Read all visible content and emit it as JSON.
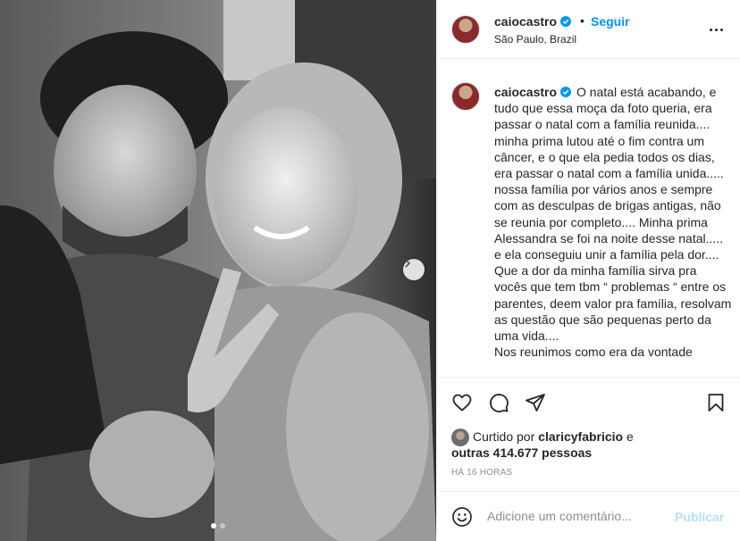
{
  "post": {
    "author": {
      "username": "caiocastro",
      "verified": true,
      "location": "São Paulo, Brazil"
    },
    "follow_label": "Seguir",
    "bullet": "•",
    "caption_text": "O natal está acabando, e tudo que essa moça da foto queria, era passar o natal com a família reunida.... minha prima lutou até o fim contra um câncer, e o que ela pedia todos os dias, era passar o natal com a família unida..... nossa família por vários anos e sempre com as desculpas de brigas antigas, não se reunia por completo.... Minha prima Alessandra se foi na noite desse natal..... e ela conseguiu unir a família pela dor....\nQue a dor da minha família sirva pra vocês que tem tbm “ problemas “ entre os parentes, deem valor pra família, resolvam as questão que são pequenas perto da uma vida....\nNos reunimos como era da vontade",
    "likes": {
      "prefix": "Curtido por",
      "liker": "claricyfabricio",
      "conjunction": "e",
      "others": "outras 414.677 pessoas"
    },
    "timestamp": "HÁ 16 HORAS",
    "comment": {
      "placeholder": "Adicione um comentário...",
      "publish_label": "Publicar"
    },
    "carousel": {
      "slides": 2,
      "active_index": 0
    }
  },
  "icons": {
    "header": [
      "verified-badge-icon",
      "more-options-icon"
    ],
    "actions": [
      "heart-icon",
      "comment-icon",
      "share-icon",
      "bookmark-icon"
    ],
    "photo": [
      "chevron-right-icon"
    ],
    "comment_bar": [
      "emoji-icon"
    ]
  },
  "colors": {
    "link_blue": "#0095f6",
    "publish_disabled": "#b2dffc",
    "text": "#262626",
    "muted": "#8e8e8e",
    "border": "#efefef"
  }
}
